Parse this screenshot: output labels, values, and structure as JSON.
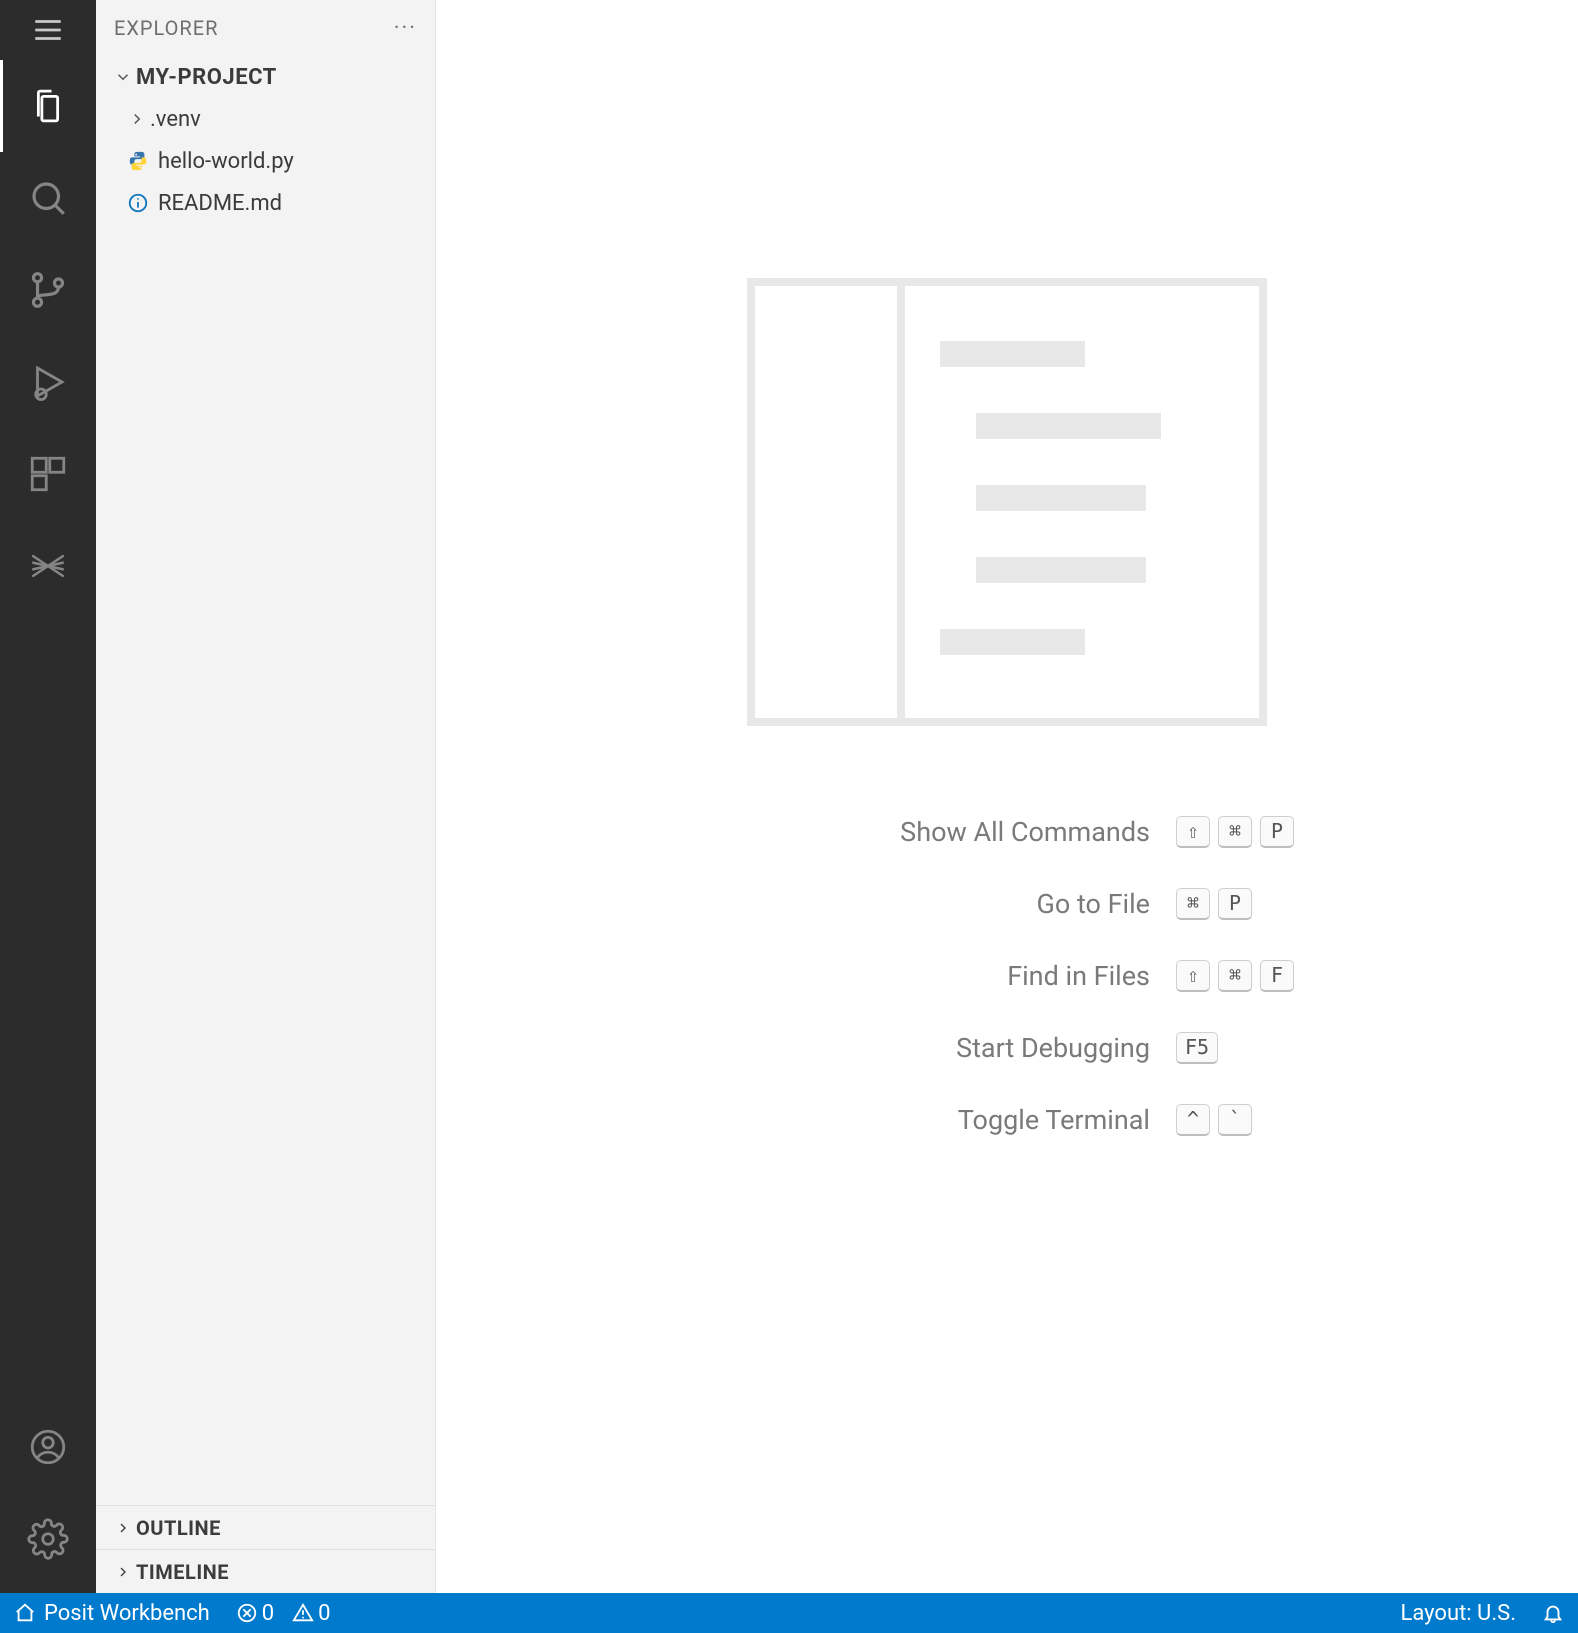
{
  "sidebar": {
    "title": "EXPLORER",
    "project": "MY-PROJECT",
    "items": [
      {
        "name": ".venv",
        "type": "folder"
      },
      {
        "name": "hello-world.py",
        "type": "python"
      },
      {
        "name": "README.md",
        "type": "info"
      }
    ],
    "sections": {
      "outline": "OUTLINE",
      "timeline": "TIMELINE"
    }
  },
  "editor": {
    "shortcuts": [
      {
        "label": "Show All Commands",
        "keys": [
          "⇧",
          "⌘",
          "P"
        ]
      },
      {
        "label": "Go to File",
        "keys": [
          "⌘",
          "P"
        ]
      },
      {
        "label": "Find in Files",
        "keys": [
          "⇧",
          "⌘",
          "F"
        ]
      },
      {
        "label": "Start Debugging",
        "keys": [
          "F5"
        ]
      },
      {
        "label": "Toggle Terminal",
        "keys": [
          "^",
          "`"
        ]
      }
    ]
  },
  "status": {
    "home": "Posit Workbench",
    "errors": "0",
    "warnings": "0",
    "layout": "Layout: U.S."
  }
}
